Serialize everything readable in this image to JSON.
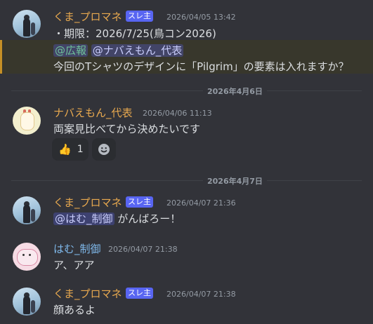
{
  "messages": [
    {
      "author": "くま_プロマネ",
      "badge": "スレ主",
      "timestamp": "2026/04/05 13:42",
      "line1": "・期限：2026/7/25(鳥コン2026)",
      "reply_role": "@広報",
      "reply_user": "@ナバえもん_代表",
      "line2": "今回のTシャツのデザインに「Pilgrim」の要素は入れますか？"
    },
    {
      "author": "ナバえもん_代表",
      "timestamp": "2026/04/06 11:13",
      "text": "両案見比べてから決めたいです",
      "reaction_count": "1",
      "reaction_emoji": "👍"
    },
    {
      "author": "くま_プロマネ",
      "badge": "スレ主",
      "timestamp": "2026/04/07 21:36",
      "mention": "@はむ_制御",
      "text": " がんばろー！"
    },
    {
      "author": "はむ_制御",
      "timestamp": "2026/04/07 21:38",
      "text": "ア、アア"
    },
    {
      "author": "くま_プロマネ",
      "badge": "スレ主",
      "timestamp": "2026/04/07 21:38",
      "text": "顔あるよ"
    }
  ],
  "dividers": [
    "2026年4月6日",
    "2026年4月7日"
  ],
  "colors": {
    "background": "#323339",
    "author_orange": "#e8a94f",
    "author_blue": "#7fb8ea",
    "badge": "#5865f2",
    "highlight_border": "#c69026"
  },
  "icons": {
    "add_reaction": "smile-icon"
  }
}
